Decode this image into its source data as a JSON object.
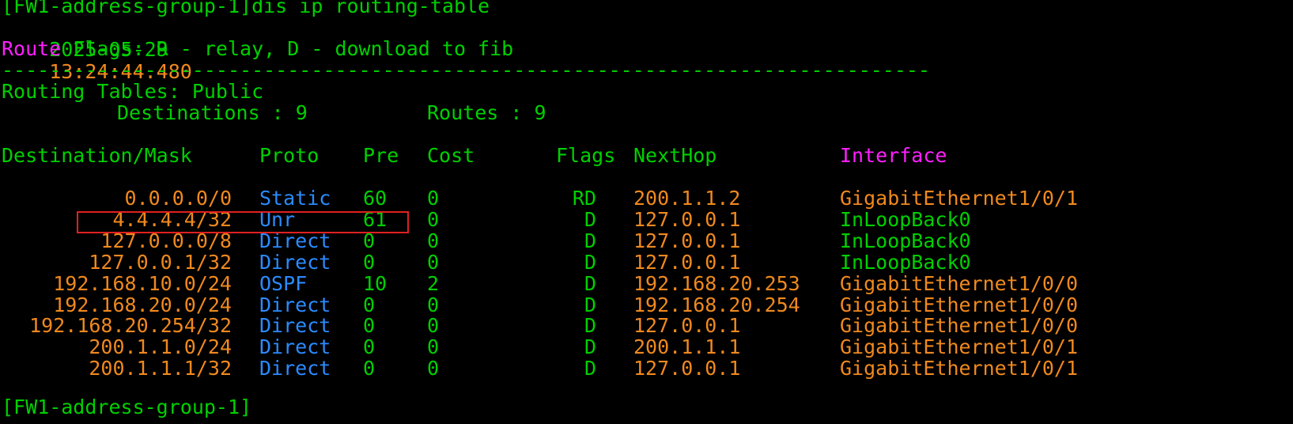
{
  "terminal": {
    "prompt_line": "[FW1-address-group-1]dis ip routing-table",
    "timestamp_date": "2025-05-29",
    "timestamp_time": "13:24:44.480",
    "flags_prefix": "Route",
    "flags_rest": " Flags: R - relay, D - download to fib",
    "separator": "------------------------------------------------------------------------------",
    "routing_tables": "Routing Tables: Public",
    "destinations_label": "Destinations : 9",
    "routes_label": "Routes : 9",
    "headers": {
      "destination": "Destination/Mask",
      "proto": "Proto",
      "pre": "Pre",
      "cost": "Cost",
      "flags": "Flags",
      "nexthop": "NextHop",
      "interface": "Interface"
    },
    "rows": [
      {
        "dest": "0.0.0.0/0",
        "proto": "Static",
        "pre": "60",
        "cost": "0",
        "flags": "RD",
        "nexthop": "200.1.1.2",
        "iface": "GigabitEthernet1/0/1"
      },
      {
        "dest": "4.4.4.4/32",
        "proto": "Unr",
        "pre": "61",
        "cost": "0",
        "flags": "D",
        "nexthop": "127.0.0.1",
        "iface": "InLoopBack0"
      },
      {
        "dest": "127.0.0.0/8",
        "proto": "Direct",
        "pre": "0",
        "cost": "0",
        "flags": "D",
        "nexthop": "127.0.0.1",
        "iface": "InLoopBack0"
      },
      {
        "dest": "127.0.0.1/32",
        "proto": "Direct",
        "pre": "0",
        "cost": "0",
        "flags": "D",
        "nexthop": "127.0.0.1",
        "iface": "InLoopBack0"
      },
      {
        "dest": "192.168.10.0/24",
        "proto": "OSPF",
        "pre": "10",
        "cost": "2",
        "flags": "D",
        "nexthop": "192.168.20.253",
        "iface": "GigabitEthernet1/0/0"
      },
      {
        "dest": "192.168.20.0/24",
        "proto": "Direct",
        "pre": "0",
        "cost": "0",
        "flags": "D",
        "nexthop": "192.168.20.254",
        "iface": "GigabitEthernet1/0/0"
      },
      {
        "dest": "192.168.20.254/32",
        "proto": "Direct",
        "pre": "0",
        "cost": "0",
        "flags": "D",
        "nexthop": "127.0.0.1",
        "iface": "GigabitEthernet1/0/0"
      },
      {
        "dest": "200.1.1.0/24",
        "proto": "Direct",
        "pre": "0",
        "cost": "0",
        "flags": "D",
        "nexthop": "200.1.1.1",
        "iface": "GigabitEthernet1/0/1"
      },
      {
        "dest": "200.1.1.1/32",
        "proto": "Direct",
        "pre": "0",
        "cost": "0",
        "flags": "D",
        "nexthop": "127.0.0.1",
        "iface": "GigabitEthernet1/0/1"
      }
    ],
    "trailing_prompt": "[FW1-address-group-1]"
  },
  "colors": {
    "background": "#000000",
    "text_green": "#00d000",
    "text_orange": "#f0891e",
    "text_magenta": "#ff1fff",
    "text_blue": "#2b8bff",
    "highlight_border": "#e02020"
  }
}
